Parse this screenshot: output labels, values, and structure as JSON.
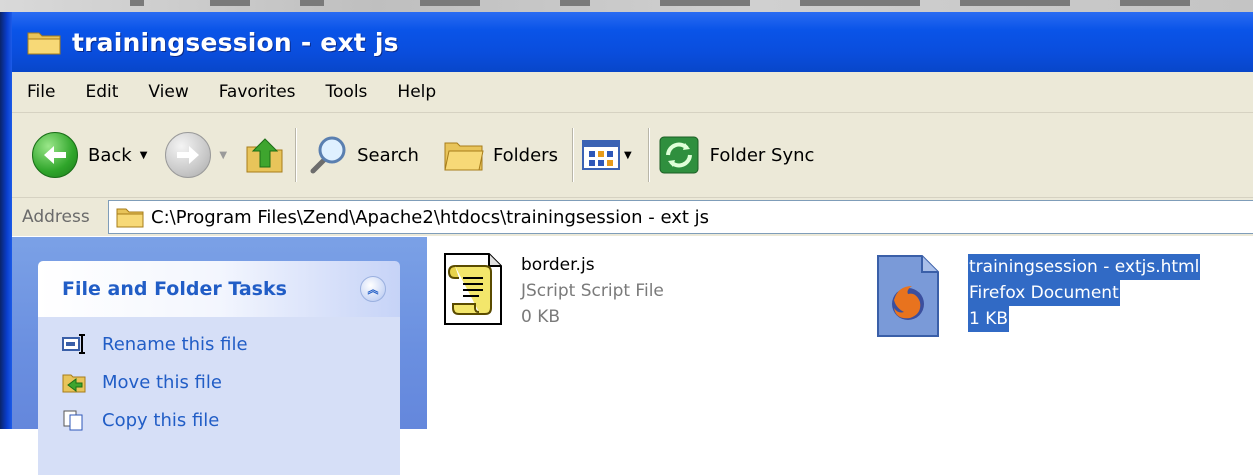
{
  "window": {
    "title": "trainingsession - ext js"
  },
  "menu": [
    "File",
    "Edit",
    "View",
    "Favorites",
    "Tools",
    "Help"
  ],
  "toolbar": {
    "back_label": "Back",
    "search_label": "Search",
    "folders_label": "Folders",
    "sync_label": "Folder Sync"
  },
  "address": {
    "label": "Address",
    "path": "C:\\Program Files\\Zend\\Apache2\\htdocs\\trainingsession - ext js"
  },
  "tasks": {
    "header": "File and Folder Tasks",
    "items": [
      "Rename this file",
      "Move this file",
      "Copy this file"
    ]
  },
  "files": [
    {
      "name": "border.js",
      "type": "JScript Script File",
      "size": "0 KB",
      "icon": "jscript-scroll-icon"
    },
    {
      "name": "trainingsession - extjs.html",
      "type": "Firefox Document",
      "size": "1 KB",
      "icon": "firefox-document-icon",
      "selected": true
    }
  ],
  "colors": {
    "titlebar": "#0a54e8",
    "chrome": "#ece9d8",
    "taskpane": "#6a8fe0",
    "link": "#215dc6",
    "selection": "#316ac5"
  }
}
